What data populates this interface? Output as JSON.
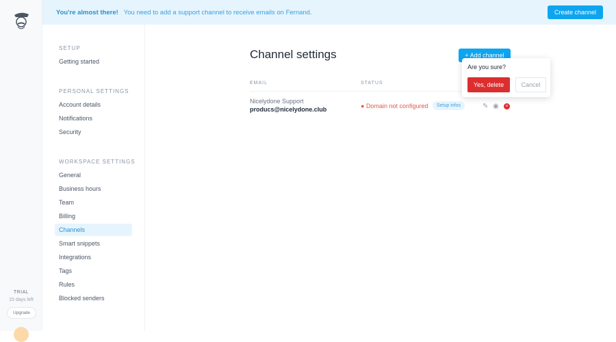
{
  "banner": {
    "title": "You're almost there!",
    "message": "You need to add a support channel to receive emails on Fernand.",
    "button": "Create channel"
  },
  "rail": {
    "trial": "TRIAL",
    "days_left": "15 days left",
    "upgrade": "Upgrade"
  },
  "sidebar": {
    "sections": [
      {
        "title": "SETUP",
        "items": [
          "Getting started"
        ]
      },
      {
        "title": "PERSONAL SETTINGS",
        "items": [
          "Account details",
          "Notifications",
          "Security"
        ]
      },
      {
        "title": "WORKSPACE SETTINGS",
        "items": [
          "General",
          "Business hours",
          "Team",
          "Billing",
          "Channels",
          "Smart snippets",
          "Integrations",
          "Tags",
          "Rules",
          "Blocked senders"
        ]
      }
    ],
    "active": "Channels"
  },
  "main": {
    "title": "Channel settings",
    "add_button": "+ Add channel",
    "columns": [
      "EMAIL",
      "STATUS"
    ],
    "rows": [
      {
        "name": "Nicelydone Support",
        "email": "producs@nicelydone.club",
        "status": "Domain not configured",
        "tag": "Setup infos"
      }
    ]
  },
  "popover": {
    "question": "Are you sure?",
    "confirm": "Yes, delete",
    "cancel": "Cancel"
  },
  "colors": {
    "accent": "#0ea5f0",
    "danger": "#dc2e2e"
  }
}
